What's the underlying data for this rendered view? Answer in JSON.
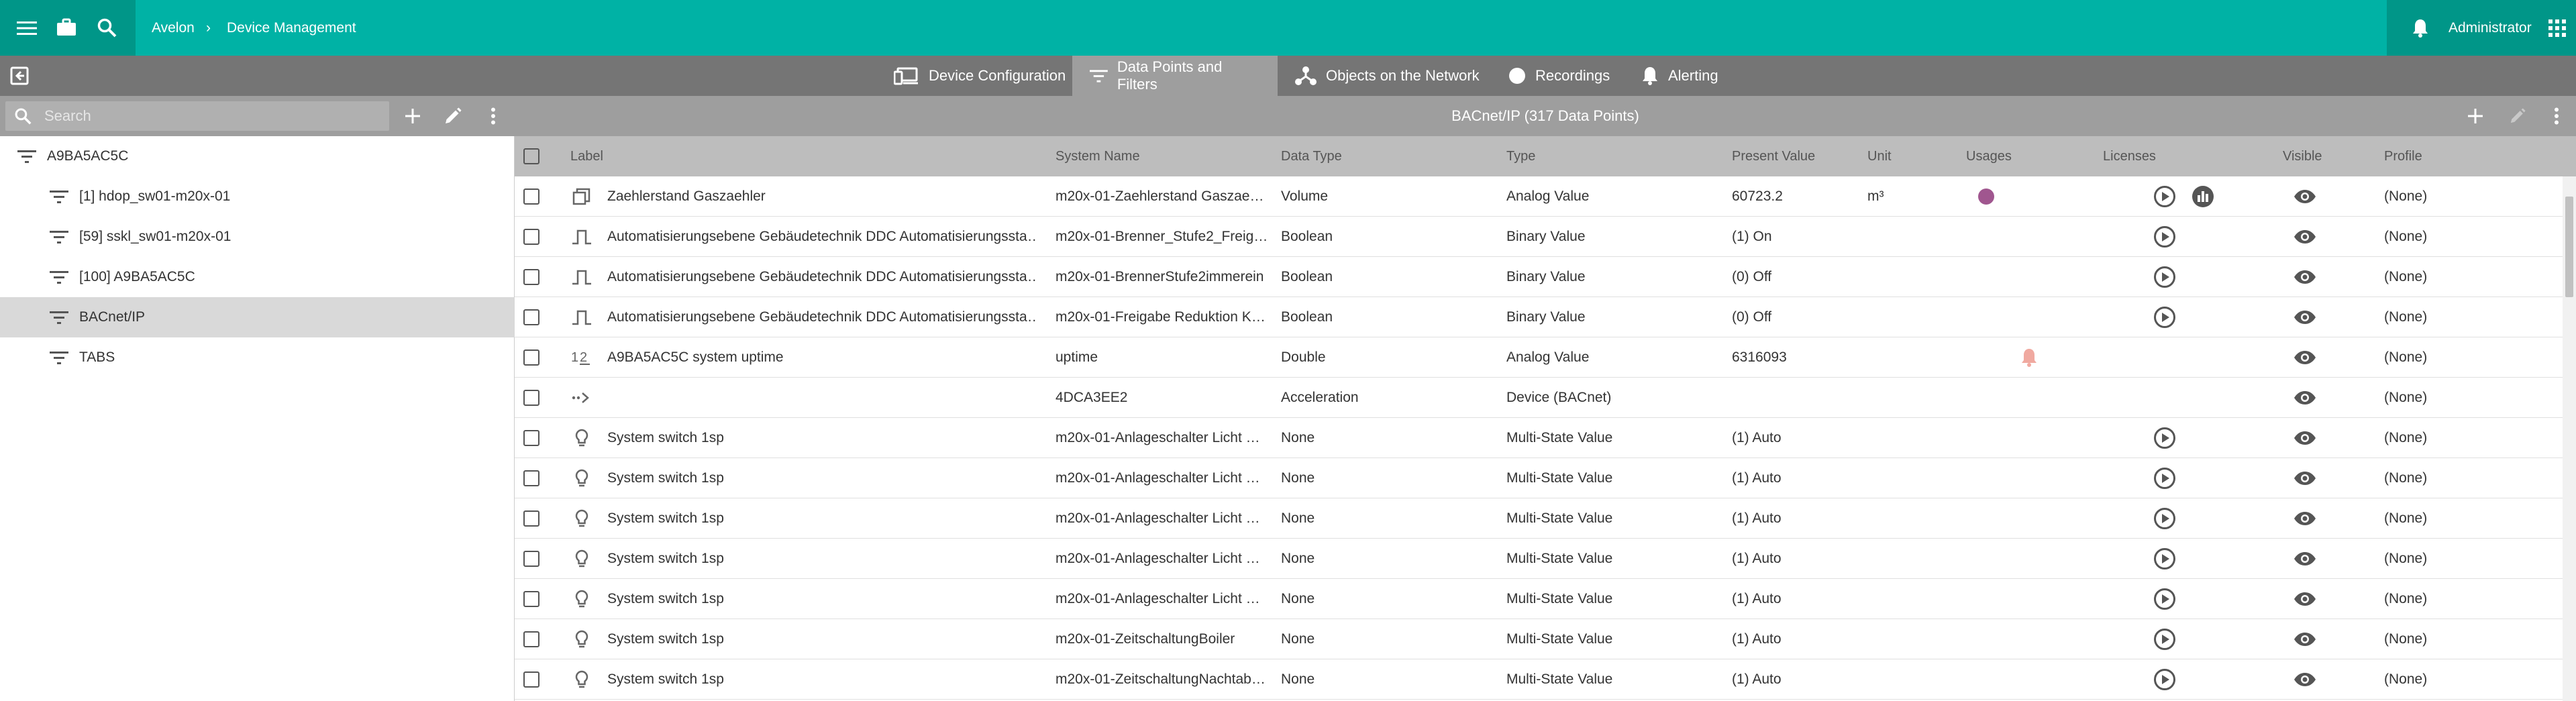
{
  "header": {
    "app": "Avelon",
    "separator": "›",
    "page": "Device Management",
    "user": "Administrator"
  },
  "nav": {
    "tabs": [
      {
        "label": "Device Configuration",
        "icon": "devices-icon"
      },
      {
        "label": "Data Points and Filters",
        "icon": "filter-icon",
        "active": true
      },
      {
        "label": "Objects on the Network",
        "icon": "network-icon"
      },
      {
        "label": "Recordings",
        "icon": "record-icon"
      },
      {
        "label": "Alerting",
        "icon": "bell-icon"
      }
    ]
  },
  "sidebar": {
    "search_placeholder": "Search",
    "tree": [
      {
        "label": "A9BA5AC5C",
        "level": 0
      },
      {
        "label": "[1] hdop_sw01-m20x-01",
        "level": 1
      },
      {
        "label": "[59] sskl_sw01-m20x-01",
        "level": 1
      },
      {
        "label": "[100] A9BA5AC5C",
        "level": 1
      },
      {
        "label": "BACnet/IP",
        "level": 1,
        "selected": true
      },
      {
        "label": "TABS",
        "level": 1
      }
    ]
  },
  "main": {
    "title": "BACnet/IP (317  Data Points)",
    "columns": [
      "Label",
      "System Name",
      "Data Type",
      "Type",
      "Present Value",
      "Unit",
      "Usages",
      "Licenses",
      "Visible",
      "Profile"
    ],
    "rows": [
      {
        "icon": "volume-icon",
        "label": "Zaehlerstand Gaszaehler",
        "system": "m20x-01-Zaehlerstand Gaszae…",
        "dtype": "Volume",
        "type": "Analog Value",
        "value": "60723.2",
        "unit": "m³",
        "usage": "dot",
        "lic": [
          "play",
          "chart"
        ],
        "profile": "(None)"
      },
      {
        "icon": "pulse-icon",
        "label": "Automatisierungsebene Gebäudetechnik DDC Automatisierungssta…",
        "system": "m20x-01-Brenner_Stufe2_Freig…",
        "dtype": "Boolean",
        "type": "Binary Value",
        "value": "(1) On",
        "unit": "",
        "usage": "",
        "lic": [
          "play"
        ],
        "profile": "(None)"
      },
      {
        "icon": "pulse-icon",
        "label": "Automatisierungsebene Gebäudetechnik DDC Automatisierungssta…",
        "system": "m20x-01-BrennerStufe2immerein",
        "dtype": "Boolean",
        "type": "Binary Value",
        "value": "(0) Off",
        "unit": "",
        "usage": "",
        "lic": [
          "play"
        ],
        "profile": "(None)"
      },
      {
        "icon": "pulse-icon",
        "label": "Automatisierungsebene Gebäudetechnik DDC Automatisierungssta…",
        "system": "m20x-01-Freigabe Reduktion K…",
        "dtype": "Boolean",
        "type": "Binary Value",
        "value": "(0) Off",
        "unit": "",
        "usage": "",
        "lic": [
          "play"
        ],
        "profile": "(None)"
      },
      {
        "icon": "numeric-icon",
        "label": "A9BA5AC5C system uptime",
        "system": "uptime",
        "dtype": "Double",
        "type": "Analog Value",
        "value": "6316093",
        "unit": "",
        "usage": "bell",
        "lic": [],
        "profile": "(None)"
      },
      {
        "icon": "device-arrow-icon",
        "label": "",
        "system": "4DCA3EE2",
        "dtype": "Acceleration",
        "type": "Device (BACnet)",
        "value": "",
        "unit": "",
        "usage": "",
        "lic": [],
        "profile": "(None)"
      },
      {
        "icon": "bulb-icon",
        "label": "System switch 1sp",
        "system": "m20x-01-Anlageschalter Licht …",
        "dtype": "None",
        "type": "Multi-State Value",
        "value": "(1) Auto",
        "unit": "",
        "usage": "",
        "lic": [
          "play"
        ],
        "profile": "(None)"
      },
      {
        "icon": "bulb-icon",
        "label": "System switch 1sp",
        "system": "m20x-01-Anlageschalter Licht …",
        "dtype": "None",
        "type": "Multi-State Value",
        "value": "(1) Auto",
        "unit": "",
        "usage": "",
        "lic": [
          "play"
        ],
        "profile": "(None)"
      },
      {
        "icon": "bulb-icon",
        "label": "System switch 1sp",
        "system": "m20x-01-Anlageschalter Licht …",
        "dtype": "None",
        "type": "Multi-State Value",
        "value": "(1) Auto",
        "unit": "",
        "usage": "",
        "lic": [
          "play"
        ],
        "profile": "(None)"
      },
      {
        "icon": "bulb-icon",
        "label": "System switch 1sp",
        "system": "m20x-01-Anlageschalter Licht …",
        "dtype": "None",
        "type": "Multi-State Value",
        "value": "(1) Auto",
        "unit": "",
        "usage": "",
        "lic": [
          "play"
        ],
        "profile": "(None)"
      },
      {
        "icon": "bulb-icon",
        "label": "System switch 1sp",
        "system": "m20x-01-Anlageschalter Licht …",
        "dtype": "None",
        "type": "Multi-State Value",
        "value": "(1) Auto",
        "unit": "",
        "usage": "",
        "lic": [
          "play"
        ],
        "profile": "(None)"
      },
      {
        "icon": "bulb-icon",
        "label": "System switch 1sp",
        "system": "m20x-01-ZeitschaltungBoiler",
        "dtype": "None",
        "type": "Multi-State Value",
        "value": "(1) Auto",
        "unit": "",
        "usage": "",
        "lic": [
          "play"
        ],
        "profile": "(None)"
      },
      {
        "icon": "bulb-icon",
        "label": "System switch 1sp",
        "system": "m20x-01-ZeitschaltungNachtab…",
        "dtype": "None",
        "type": "Multi-State Value",
        "value": "(1) Auto",
        "unit": "",
        "usage": "",
        "lic": [
          "play"
        ],
        "profile": "(None)"
      }
    ]
  },
  "colors": {
    "teal": "#00b2a5",
    "teal_dark": "#009688",
    "usage_dot": "#a0568f",
    "bell": "#f0a9a0"
  }
}
